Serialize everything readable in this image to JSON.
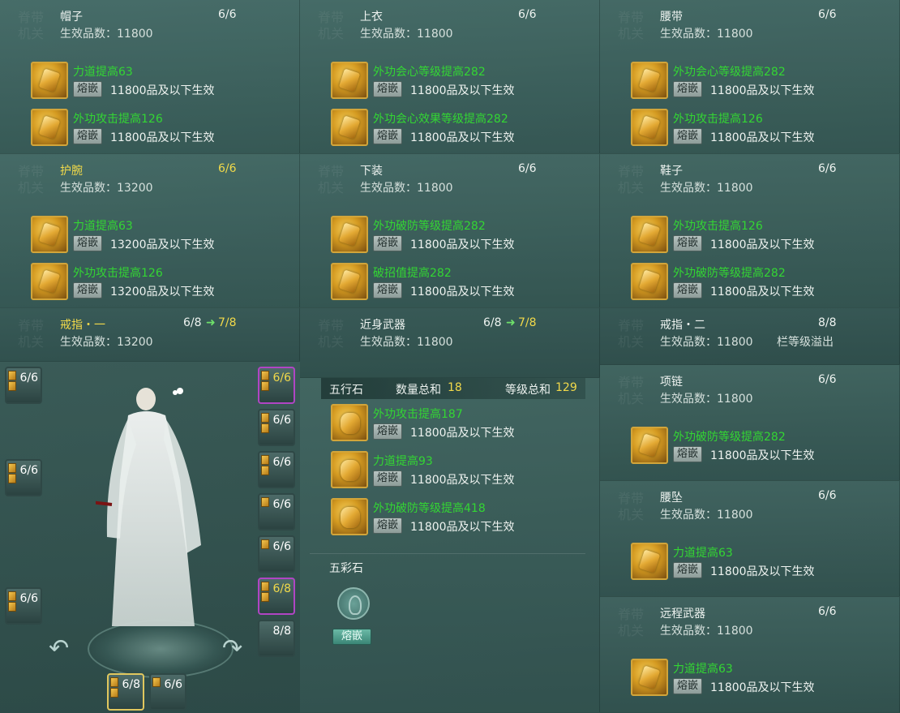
{
  "watermark": "脊带\n机关",
  "labels": {
    "grade_prefix": "生效品数：",
    "fuse": "熔嵌",
    "next_arrow": "➜"
  },
  "panels": {
    "hat": {
      "name": "帽子",
      "count": "6/6",
      "grade": "11800",
      "gems": [
        {
          "effect": "力道提高63",
          "limit": "11800品及以下生效"
        },
        {
          "effect": "外功攻击提高126",
          "limit": "11800品及以下生效"
        }
      ]
    },
    "top": {
      "name": "上衣",
      "count": "6/6",
      "grade": "11800",
      "gems": [
        {
          "effect": "外功会心等级提高282",
          "limit": "11800品及以下生效"
        },
        {
          "effect": "外功会心效果等级提高282",
          "limit": "11800品及以下生效"
        }
      ]
    },
    "belt": {
      "name": "腰带",
      "count": "6/6",
      "grade": "11800",
      "gems": [
        {
          "effect": "外功会心等级提高282",
          "limit": "11800品及以下生效"
        },
        {
          "effect": "外功攻击提高126",
          "limit": "11800品及以下生效"
        }
      ]
    },
    "wrist": {
      "name": "护腕",
      "count": "6/6",
      "grade": "13200",
      "gems": [
        {
          "effect": "力道提高63",
          "limit": "13200品及以下生效"
        },
        {
          "effect": "外功攻击提高126",
          "limit": "13200品及以下生效"
        }
      ]
    },
    "pants": {
      "name": "下装",
      "count": "6/6",
      "grade": "11800",
      "gems": [
        {
          "effect": "外功破防等级提高282",
          "limit": "11800品及以下生效"
        },
        {
          "effect": "破招值提高282",
          "limit": "11800品及以下生效"
        }
      ]
    },
    "shoes": {
      "name": "鞋子",
      "count": "6/6",
      "grade": "11800",
      "gems": [
        {
          "effect": "外功攻击提高126",
          "limit": "11800品及以下生效"
        },
        {
          "effect": "外功破防等级提高282",
          "limit": "11800品及以下生效"
        }
      ]
    },
    "ring1": {
      "name": "戒指・一",
      "count": "6/8",
      "next": "7/8",
      "grade": "13200"
    },
    "melee": {
      "name": "近身武器",
      "count": "6/8",
      "next": "7/8",
      "grade": "11800"
    },
    "ring2": {
      "name": "戒指・二",
      "count": "8/8",
      "grade": "11800",
      "note": "栏等级溢出"
    },
    "necklace": {
      "name": "项链",
      "count": "6/6",
      "grade": "11800",
      "gems": [
        {
          "effect": "外功破防等级提高282",
          "limit": "11800品及以下生效"
        }
      ]
    },
    "pendant": {
      "name": "腰坠",
      "count": "6/6",
      "grade": "11800",
      "gems": [
        {
          "effect": "力道提高63",
          "limit": "11800品及以下生效"
        }
      ]
    },
    "ranged": {
      "name": "远程武器",
      "count": "6/6",
      "grade": "11800",
      "gems": [
        {
          "effect": "力道提高63",
          "limit": "11800品及以下生效"
        }
      ]
    }
  },
  "wuxing": {
    "title": "五行石",
    "count_label": "数量总和",
    "count": "18",
    "level_label": "等级总和",
    "level": "129",
    "gems": [
      {
        "effect": "外功攻击提高187",
        "limit": "11800品及以下生效"
      },
      {
        "effect": "力道提高93",
        "limit": "11800品及以下生效"
      },
      {
        "effect": "外功破防等级提高418",
        "limit": "11800品及以下生效"
      }
    ]
  },
  "wucai": {
    "title": "五彩石",
    "button": "熔嵌"
  },
  "slots": {
    "left": [
      "6/6",
      "6/6",
      "6/6"
    ],
    "right": [
      "6/6",
      "6/6",
      "6/6",
      "6/6",
      "6/6",
      "6/8",
      "8/8"
    ],
    "bottom": [
      "6/8",
      "6/6"
    ]
  },
  "colors": {
    "effect_green": "#33d633",
    "highlight_yellow": "#f1d94a",
    "gem_gold": "#d2a53a",
    "purple_border": "#b045c4"
  }
}
